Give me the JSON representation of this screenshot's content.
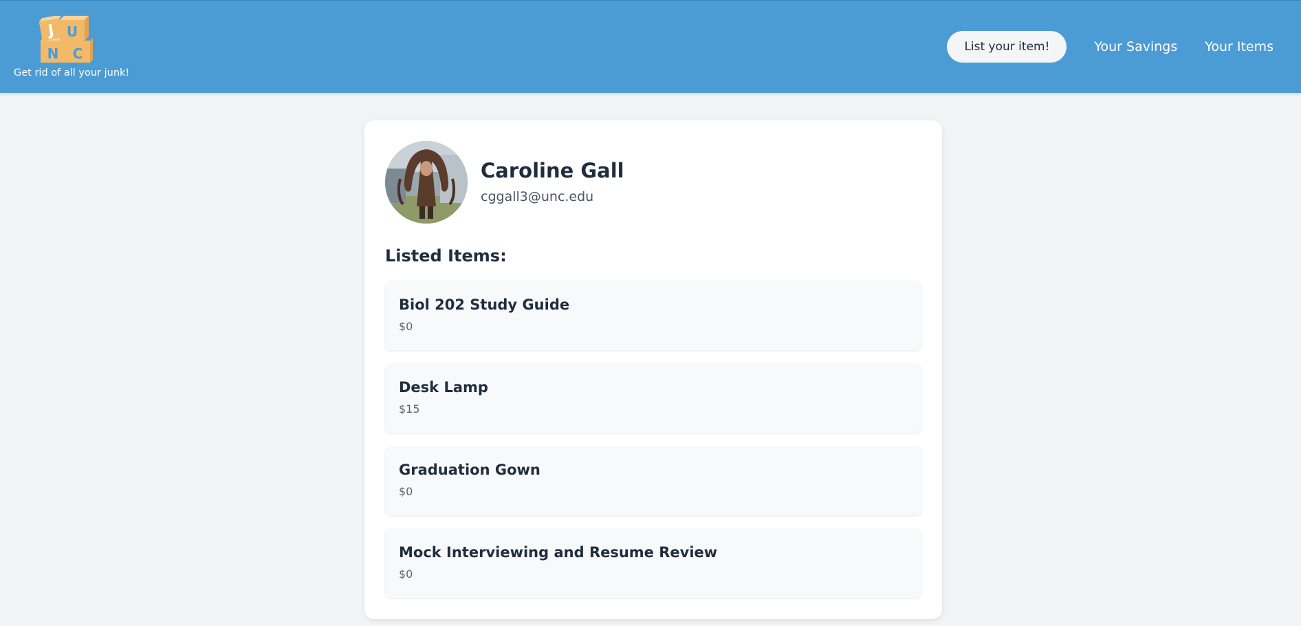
{
  "header": {
    "logo_letters": [
      "J",
      "U",
      "N",
      "C"
    ],
    "tagline": "Get rid of all your junk!",
    "list_button": "List your item!",
    "nav_links": [
      "Your Savings",
      "Your Items"
    ]
  },
  "profile": {
    "name": "Caroline Gall",
    "email": "cggall3@unc.edu"
  },
  "listed_heading": "Listed Items:",
  "items": [
    {
      "title": "Biol 202 Study Guide",
      "price": "$0"
    },
    {
      "title": "Desk Lamp",
      "price": "$15"
    },
    {
      "title": "Graduation Gown",
      "price": "$0"
    },
    {
      "title": "Mock Interviewing and Resume Review",
      "price": "$0"
    }
  ],
  "colors": {
    "navbar": "#4b9cd5",
    "page_bg": "#f2f3f5",
    "block_fill": "#f2b969",
    "block_letter_blue": "#4b9cd5"
  }
}
